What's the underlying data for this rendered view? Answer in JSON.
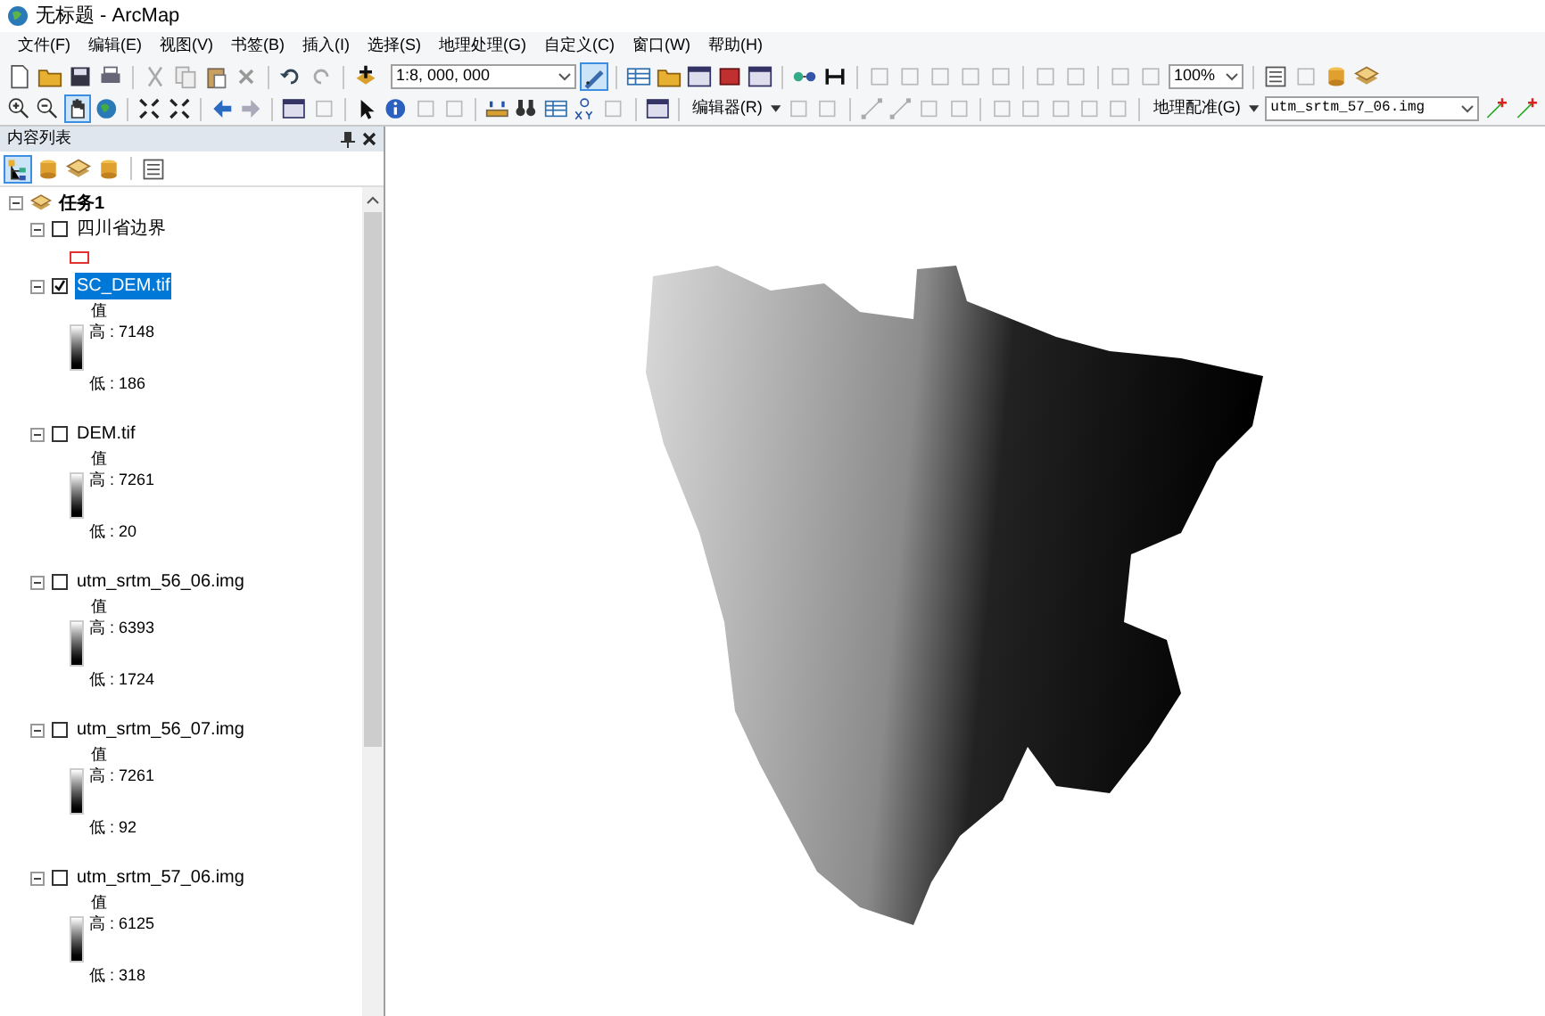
{
  "window": {
    "title": "无标题 - ArcMap"
  },
  "menu": [
    {
      "label": "文件(F)"
    },
    {
      "label": "编辑(E)"
    },
    {
      "label": "视图(V)"
    },
    {
      "label": "书签(B)"
    },
    {
      "label": "插入(I)"
    },
    {
      "label": "选择(S)"
    },
    {
      "label": "地理处理(G)"
    },
    {
      "label": "自定义(C)"
    },
    {
      "label": "窗口(W)"
    },
    {
      "label": "帮助(H)"
    }
  ],
  "toolbar": {
    "scale": "1:8, 000, 000",
    "zoom": "100%",
    "editor_menu": "编辑器(R)",
    "georef_menu": "地理配准(G)",
    "georef_layer": "utm_srtm_57_06.img"
  },
  "toc": {
    "title": "内容列表",
    "group": {
      "name": "任务1",
      "expanded": true
    },
    "layers": [
      {
        "name": "四川省边界",
        "kind": "polygon",
        "checked": false,
        "selected": false,
        "expanded": true
      },
      {
        "name": "SC_DEM.tif",
        "kind": "raster",
        "checked": true,
        "selected": true,
        "expanded": true,
        "heading": "值",
        "high": "高 : 7148",
        "low": "低 : 186"
      },
      {
        "name": "DEM.tif",
        "kind": "raster",
        "checked": false,
        "selected": false,
        "expanded": true,
        "heading": "值",
        "high": "高 : 7261",
        "low": "低 : 20"
      },
      {
        "name": "utm_srtm_56_06.img",
        "kind": "raster",
        "checked": false,
        "selected": false,
        "expanded": true,
        "heading": "值",
        "high": "高 : 6393",
        "low": "低 : 1724"
      },
      {
        "name": "utm_srtm_56_07.img",
        "kind": "raster",
        "checked": false,
        "selected": false,
        "expanded": true,
        "heading": "值",
        "high": "高 : 7261",
        "low": "低 : 92"
      },
      {
        "name": "utm_srtm_57_06.img",
        "kind": "raster",
        "checked": false,
        "selected": false,
        "expanded": true,
        "heading": "值",
        "high": "高 : 6125",
        "low": "低 : 318"
      }
    ]
  }
}
